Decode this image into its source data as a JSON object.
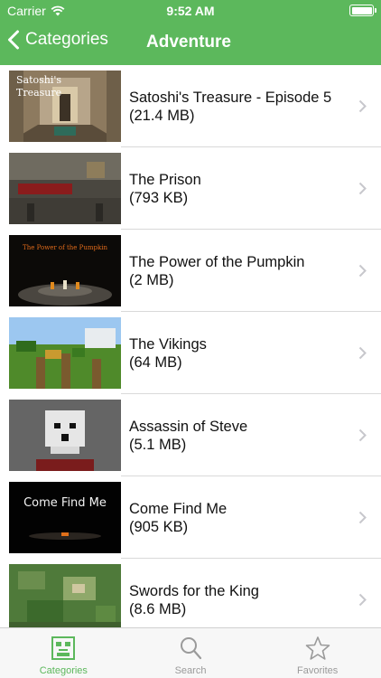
{
  "status_bar": {
    "carrier": "Carrier",
    "time": "9:52 AM"
  },
  "nav": {
    "back_label": "Categories",
    "title": "Adventure"
  },
  "maps": [
    {
      "title": "Satoshi's Treasure - Episode 5",
      "size": "(21.4 MB)",
      "thumb_text": "Satoshi's Treasure"
    },
    {
      "title": "The Prison",
      "size": "(793 KB)"
    },
    {
      "title": "The Power of the Pumpkin",
      "size": "(2 MB)",
      "thumb_text": "The Power of the Pumpkin"
    },
    {
      "title": "The Vikings",
      "size": "(64 MB)"
    },
    {
      "title": "Assassin of Steve",
      "size": "(5.1 MB)"
    },
    {
      "title": "Come Find Me",
      "size": "(905 KB)",
      "thumb_text": "Come Find Me"
    },
    {
      "title": "Swords for the King",
      "size": "(8.6 MB)"
    }
  ],
  "tabs": [
    {
      "label": "Categories",
      "icon": "categories-icon",
      "active": true
    },
    {
      "label": "Search",
      "icon": "search-icon",
      "active": false
    },
    {
      "label": "Favorites",
      "icon": "star-icon",
      "active": false
    }
  ],
  "colors": {
    "accent": "#5cb85c",
    "inactive": "#9a9a9a"
  }
}
